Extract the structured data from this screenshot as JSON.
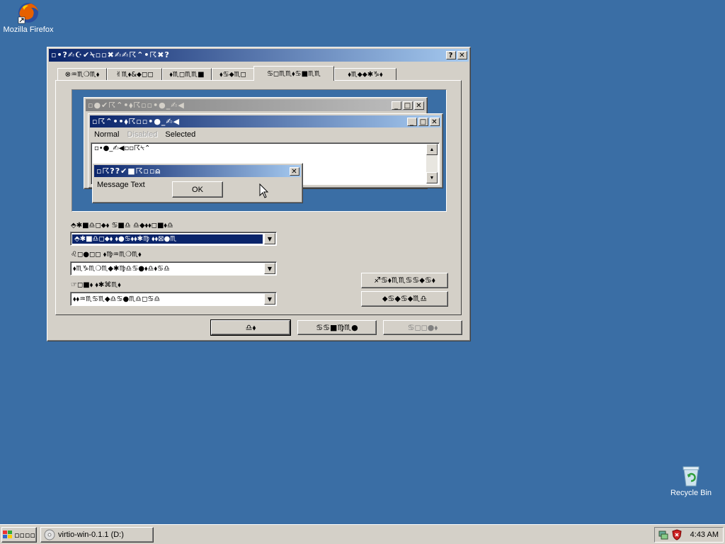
{
  "desktop": {
    "firefox_label": "Mozilla Firefox",
    "recycle_label": "Recycle Bin"
  },
  "main_window": {
    "title": "▫•?✍☪✔⍀▫▫✖✍✍☈⌃•☈✖?",
    "help_btn": "?",
    "close_btn": "✕",
    "tabs": [
      "⊗♒♏❍♏⬧",
      "✌♏⬧&⬥◻◻",
      "⬧♏◻♏♏■",
      "⬧♋⬥♏◻",
      "♋◻♏♏⬧♋■♏♏",
      "⬧♏⬥⬥✱♑⬧"
    ],
    "combo1_label": "⬘✱■♎◻⬥⬧  ♋■♎  ♎◆⬧⬧◻■⬧♎",
    "combo1_value": "⬘✱■♎◻⬥⬧ ⬧●♋⬧⬧✱♍  ⬧⬧⊠●♏",
    "combo2_label": "♌◻●◻◻  ⬧♍♒♏❍♏⬧",
    "combo2_value": "⬧♏♑♏❍♏◆✱♍♎♋●⬧♎⬧♋♎",
    "combo3_label": "☞◻■⬧  ⬧✱⌘♏⬧",
    "combo3_value": "⬧⬧♒♏♋♏◆♎♋●♏♎◻♋♎",
    "side_btn1": "♐♋⬧♏♏♋♋⬥♋⬧",
    "side_btn2": "⬥♋◆♋⬥♏♎",
    "ok_btn": "♎⬧",
    "cancel_btn": "♋♋■♍♏●",
    "apply_btn": "♋◻◻●⬧"
  },
  "preview": {
    "inactive_title": "▫●✔☈⌃•⬧☈▫▫•●_✍◀",
    "active_title": "▫☈⌃••⬧☈▫▫•●_✍◀",
    "menu_normal": "Normal",
    "menu_disabled": "Disabled",
    "menu_selected": "Selected",
    "window_text": "▫•●_✍◀▫▫☈⍀⌃",
    "msgbox_title": "▫☈??✔■☈▫▫⍝",
    "msg_text": "Message Text",
    "ok_label": "OK"
  },
  "taskbar": {
    "start_label": "▫▫▫▫",
    "task_label": "virtio-win-0.1.1 (D:)",
    "clock": "4:43 AM"
  },
  "colors": {
    "desktop": "#3a6ea5",
    "active_title_start": "#0a246a",
    "active_title_end": "#a6caf0",
    "face": "#d4d0c8"
  }
}
